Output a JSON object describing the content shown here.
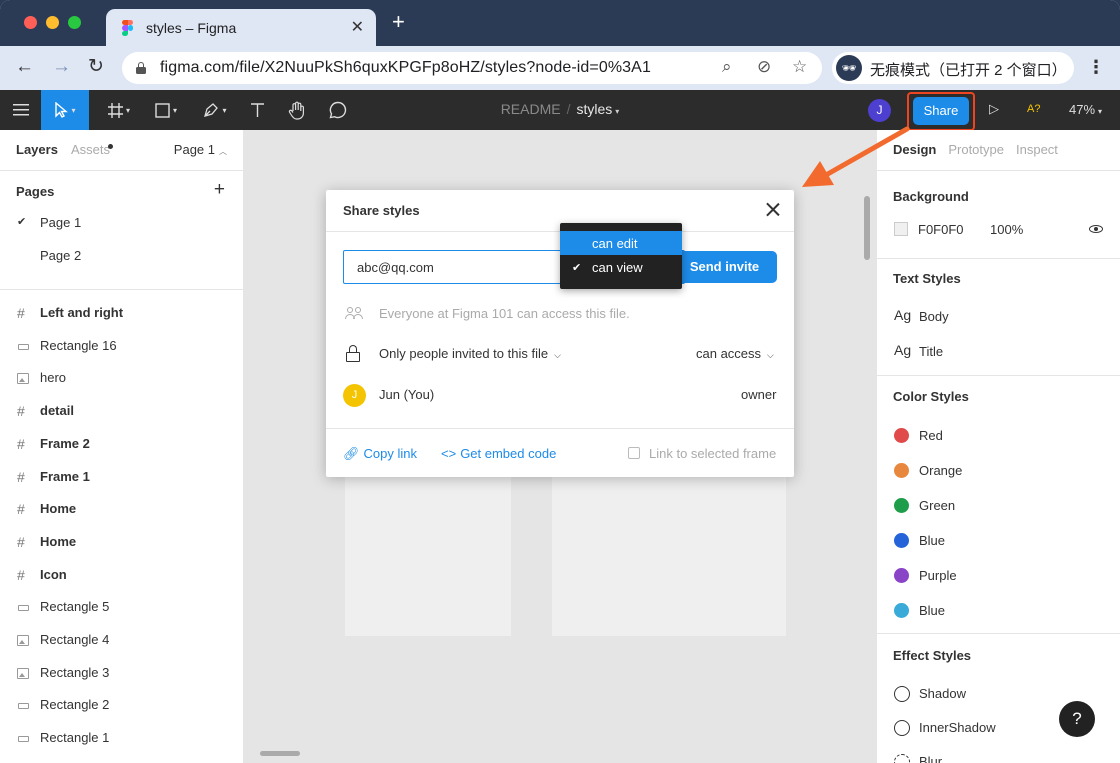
{
  "browser": {
    "tab_title": "styles – Figma",
    "url": "figma.com/file/X2NuuPkSh6quxKPGFp8oHZ/styles?node-id=0%3A1",
    "incognito_label": "无痕模式（已打开 2 个窗口）",
    "incognito_avatar": "🕶"
  },
  "figma_toolbar": {
    "project": "README",
    "separator": "/",
    "file": "styles",
    "avatar_initial": "J",
    "share_label": "Share",
    "font_indicator": "A?",
    "zoom": "47%"
  },
  "left_panel": {
    "tab_layers": "Layers",
    "tab_assets": "Assets",
    "current_page": "Page 1",
    "pages_heading": "Pages",
    "pages": [
      {
        "label": "Page 1",
        "checked": true
      },
      {
        "label": "Page 2",
        "checked": false
      }
    ],
    "layers": [
      {
        "label": "Left and right",
        "icon": "frame",
        "bold": true
      },
      {
        "label": "Rectangle 16",
        "icon": "rect",
        "bold": false
      },
      {
        "label": "hero",
        "icon": "image",
        "bold": false
      },
      {
        "label": "detail",
        "icon": "frame",
        "bold": true
      },
      {
        "label": "Frame 2",
        "icon": "frame",
        "bold": true
      },
      {
        "label": "Frame 1",
        "icon": "frame",
        "bold": true
      },
      {
        "label": "Home",
        "icon": "frame",
        "bold": true
      },
      {
        "label": "Home",
        "icon": "frame",
        "bold": true
      },
      {
        "label": "Icon",
        "icon": "frame",
        "bold": true
      },
      {
        "label": "Rectangle 5",
        "icon": "rect",
        "bold": false
      },
      {
        "label": "Rectangle 4",
        "icon": "image",
        "bold": false
      },
      {
        "label": "Rectangle 3",
        "icon": "image",
        "bold": false
      },
      {
        "label": "Rectangle 2",
        "icon": "rect",
        "bold": false
      },
      {
        "label": "Rectangle 1",
        "icon": "rect",
        "bold": false
      }
    ]
  },
  "right_panel": {
    "tabs": [
      "Design",
      "Prototype",
      "Inspect"
    ],
    "active_tab": "Design",
    "background_heading": "Background",
    "background_hex": "F0F0F0",
    "background_opacity": "100%",
    "text_styles_heading": "Text Styles",
    "text_styles": [
      {
        "glyph": "Ag",
        "label": "Body"
      },
      {
        "glyph": "Ag",
        "label": "Title"
      }
    ],
    "color_styles_heading": "Color Styles",
    "color_styles": [
      {
        "label": "Red",
        "color": "#e04a4a"
      },
      {
        "label": "Orange",
        "color": "#e8883e"
      },
      {
        "label": "Green",
        "color": "#1e9e4a"
      },
      {
        "label": "Blue",
        "color": "#2464d8"
      },
      {
        "label": "Purple",
        "color": "#8a44c8"
      },
      {
        "label": "Blue",
        "color": "#3aaad8"
      }
    ],
    "effect_styles_heading": "Effect Styles",
    "effect_styles": [
      {
        "label": "Shadow"
      },
      {
        "label": "InnerShadow"
      },
      {
        "label": "Blur"
      }
    ],
    "help_label": "?"
  },
  "share_modal": {
    "title": "Share styles",
    "email_value": "abc@qq.com",
    "send_label": "Send invite",
    "everyone_text": "Everyone at Figma 101 can access this file.",
    "access_scope": "Only people invited to this file",
    "access_level": "can access",
    "user_initial": "J",
    "user_name": "Jun (You)",
    "user_role": "owner",
    "copy_link": "Copy link",
    "embed_code": "Get embed code",
    "frame_label": "Link to selected frame"
  },
  "permission_menu": {
    "options": [
      {
        "label": "can edit",
        "highlighted": true,
        "checked": false
      },
      {
        "label": "can view",
        "highlighted": false,
        "checked": true
      }
    ]
  },
  "colors": {
    "accent": "#1d8be8",
    "annotation": "#ee4422",
    "figma_bar": "#2c2c2c",
    "chrome": "#2b3a55"
  }
}
